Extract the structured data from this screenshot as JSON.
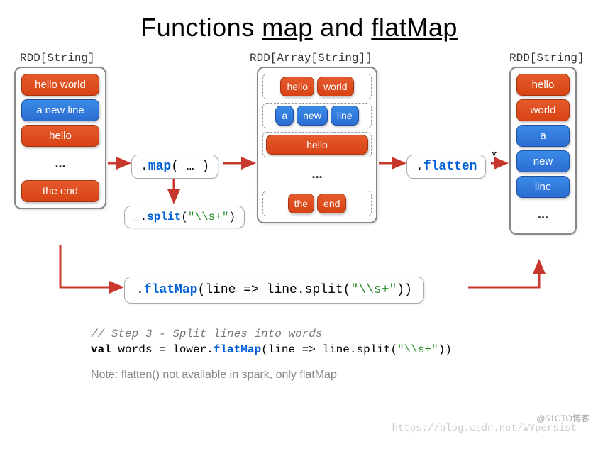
{
  "title": {
    "prefix": "Functions ",
    "map": "map",
    "and": " and ",
    "flatMap": "flatMap"
  },
  "labels": {
    "rdd1": "RDD[String]",
    "rdd2": "RDD[Array[String]]",
    "rdd3": "RDD[String]"
  },
  "rdd1": [
    "hello world",
    "a new line",
    "hello",
    "...",
    "the end"
  ],
  "rdd2": {
    "g1": [
      "hello",
      "world"
    ],
    "g2": [
      "a",
      "new",
      "line"
    ],
    "g3": [
      "hello"
    ],
    "dots": "...",
    "g4": [
      "the",
      "end"
    ]
  },
  "rdd3": [
    "hello",
    "world",
    "a",
    "new",
    "line",
    "..."
  ],
  "mapBox": {
    "dot": ".",
    "fn": "map",
    "args": "( … )"
  },
  "splitBox": {
    "pre": "_.",
    "fn": "split",
    "arg1": "(",
    "str": "\"\\\\s+\"",
    "arg2": ")"
  },
  "flattenBox": {
    "dot": ".",
    "fn": "flatten",
    "star": "*"
  },
  "flatMapBox": {
    "dot": ".",
    "fn": "flatMap",
    "rest1": "(line => line.split(",
    "str": "\"\\\\s+\"",
    "rest2": "))"
  },
  "code": {
    "comment": "// Step 3 - Split lines into words",
    "kw": "val",
    "var": " words  = lower.",
    "fm": "flatMap",
    "rest1": "(line => line.split(",
    "str": "\"\\\\s+\"",
    "rest2": "))"
  },
  "note": "Note: flatten() not available in spark, only flatMap",
  "watermark": "@51CTO博客",
  "watermark2": "https://blog.csdn.net/WYpersist"
}
